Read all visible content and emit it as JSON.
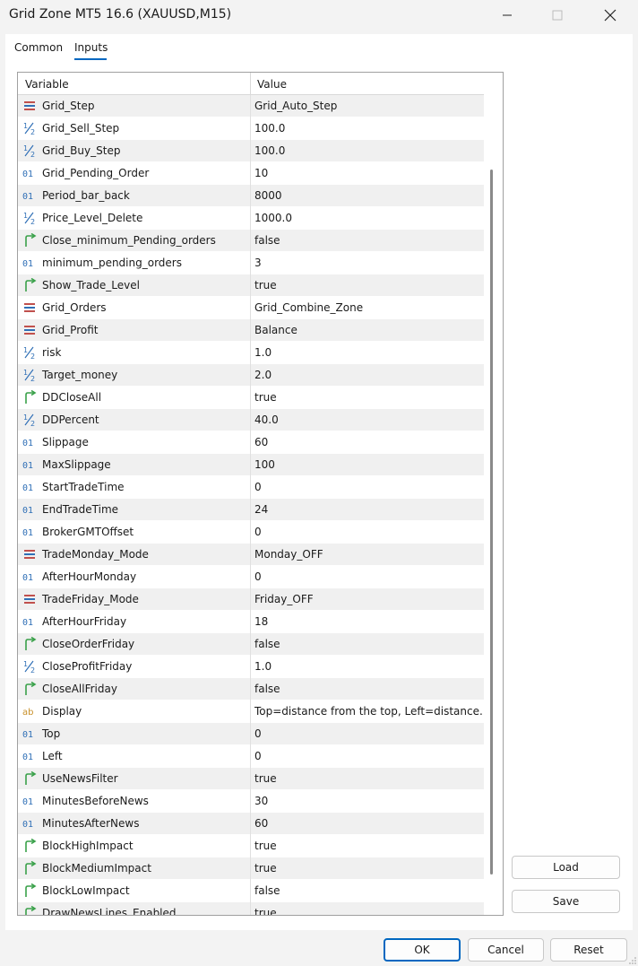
{
  "window": {
    "title": "Grid Zone MT5 16.6 (XAUUSD,M15)",
    "minimize_glyph": "—",
    "maximize_glyph": "☐",
    "close_glyph": "✕"
  },
  "tabs": [
    {
      "label": "Common",
      "active": false
    },
    {
      "label": "Inputs",
      "active": true
    }
  ],
  "table": {
    "headers": {
      "variable": "Variable",
      "value": "Value"
    },
    "rows": [
      {
        "icon": "enum-icon",
        "name": "Grid_Step",
        "value": "Grid_Auto_Step"
      },
      {
        "icon": "double-icon",
        "name": "Grid_Sell_Step",
        "value": "100.0"
      },
      {
        "icon": "double-icon",
        "name": "Grid_Buy_Step",
        "value": "100.0"
      },
      {
        "icon": "int-icon",
        "name": "Grid_Pending_Order",
        "value": "10"
      },
      {
        "icon": "int-icon",
        "name": "Period_bar_back",
        "value": "8000"
      },
      {
        "icon": "double-icon",
        "name": "Price_Level_Delete",
        "value": "1000.0"
      },
      {
        "icon": "bool-icon",
        "name": "Close_minimum_Pending_orders",
        "value": "false"
      },
      {
        "icon": "int-icon",
        "name": "minimum_pending_orders",
        "value": "3"
      },
      {
        "icon": "bool-icon",
        "name": "Show_Trade_Level",
        "value": "true"
      },
      {
        "icon": "enum-icon",
        "name": "Grid_Orders",
        "value": "Grid_Combine_Zone"
      },
      {
        "icon": "enum-icon",
        "name": "Grid_Profit",
        "value": "Balance"
      },
      {
        "icon": "double-icon",
        "name": "risk",
        "value": "1.0"
      },
      {
        "icon": "double-icon",
        "name": "Target_money",
        "value": "2.0"
      },
      {
        "icon": "bool-icon",
        "name": "DDCloseAll",
        "value": "true"
      },
      {
        "icon": "double-icon",
        "name": "DDPercent",
        "value": "40.0"
      },
      {
        "icon": "int-icon",
        "name": "Slippage",
        "value": "60"
      },
      {
        "icon": "int-icon",
        "name": "MaxSlippage",
        "value": "100"
      },
      {
        "icon": "int-icon",
        "name": "StartTradeTime",
        "value": "0"
      },
      {
        "icon": "int-icon",
        "name": "EndTradeTime",
        "value": "24"
      },
      {
        "icon": "int-icon",
        "name": "BrokerGMTOffset",
        "value": "0"
      },
      {
        "icon": "enum-icon",
        "name": "TradeMonday_Mode",
        "value": "Monday_OFF"
      },
      {
        "icon": "int-icon",
        "name": "AfterHourMonday",
        "value": "0"
      },
      {
        "icon": "enum-icon",
        "name": "TradeFriday_Mode",
        "value": "Friday_OFF"
      },
      {
        "icon": "int-icon",
        "name": "AfterHourFriday",
        "value": "18"
      },
      {
        "icon": "bool-icon",
        "name": "CloseOrderFriday",
        "value": "false"
      },
      {
        "icon": "double-icon",
        "name": "CloseProfitFriday",
        "value": "1.0"
      },
      {
        "icon": "bool-icon",
        "name": "CloseAllFriday",
        "value": "false"
      },
      {
        "icon": "string-icon",
        "name": "Display",
        "value": "Top=distance from the top, Left=distance..."
      },
      {
        "icon": "int-icon",
        "name": "Top",
        "value": "0"
      },
      {
        "icon": "int-icon",
        "name": "Left",
        "value": "0"
      },
      {
        "icon": "bool-icon",
        "name": "UseNewsFilter",
        "value": "true"
      },
      {
        "icon": "int-icon",
        "name": "MinutesBeforeNews",
        "value": "30"
      },
      {
        "icon": "int-icon",
        "name": "MinutesAfterNews",
        "value": "60"
      },
      {
        "icon": "bool-icon",
        "name": "BlockHighImpact",
        "value": "true"
      },
      {
        "icon": "bool-icon",
        "name": "BlockMediumImpact",
        "value": "true"
      },
      {
        "icon": "bool-icon",
        "name": "BlockLowImpact",
        "value": "false"
      },
      {
        "icon": "bool-icon",
        "name": "DrawNewsLines_Enabled",
        "value": "true"
      }
    ]
  },
  "side_buttons": {
    "load": "Load",
    "save": "Save"
  },
  "footer_buttons": {
    "ok": "OK",
    "cancel": "Cancel",
    "reset": "Reset"
  },
  "colors": {
    "accent": "#0067c0",
    "enum": "#c0504d",
    "int": "#2f6fb6",
    "double": "#2f6fb6",
    "bool": "#3aa14a",
    "string": "#c8902a"
  }
}
